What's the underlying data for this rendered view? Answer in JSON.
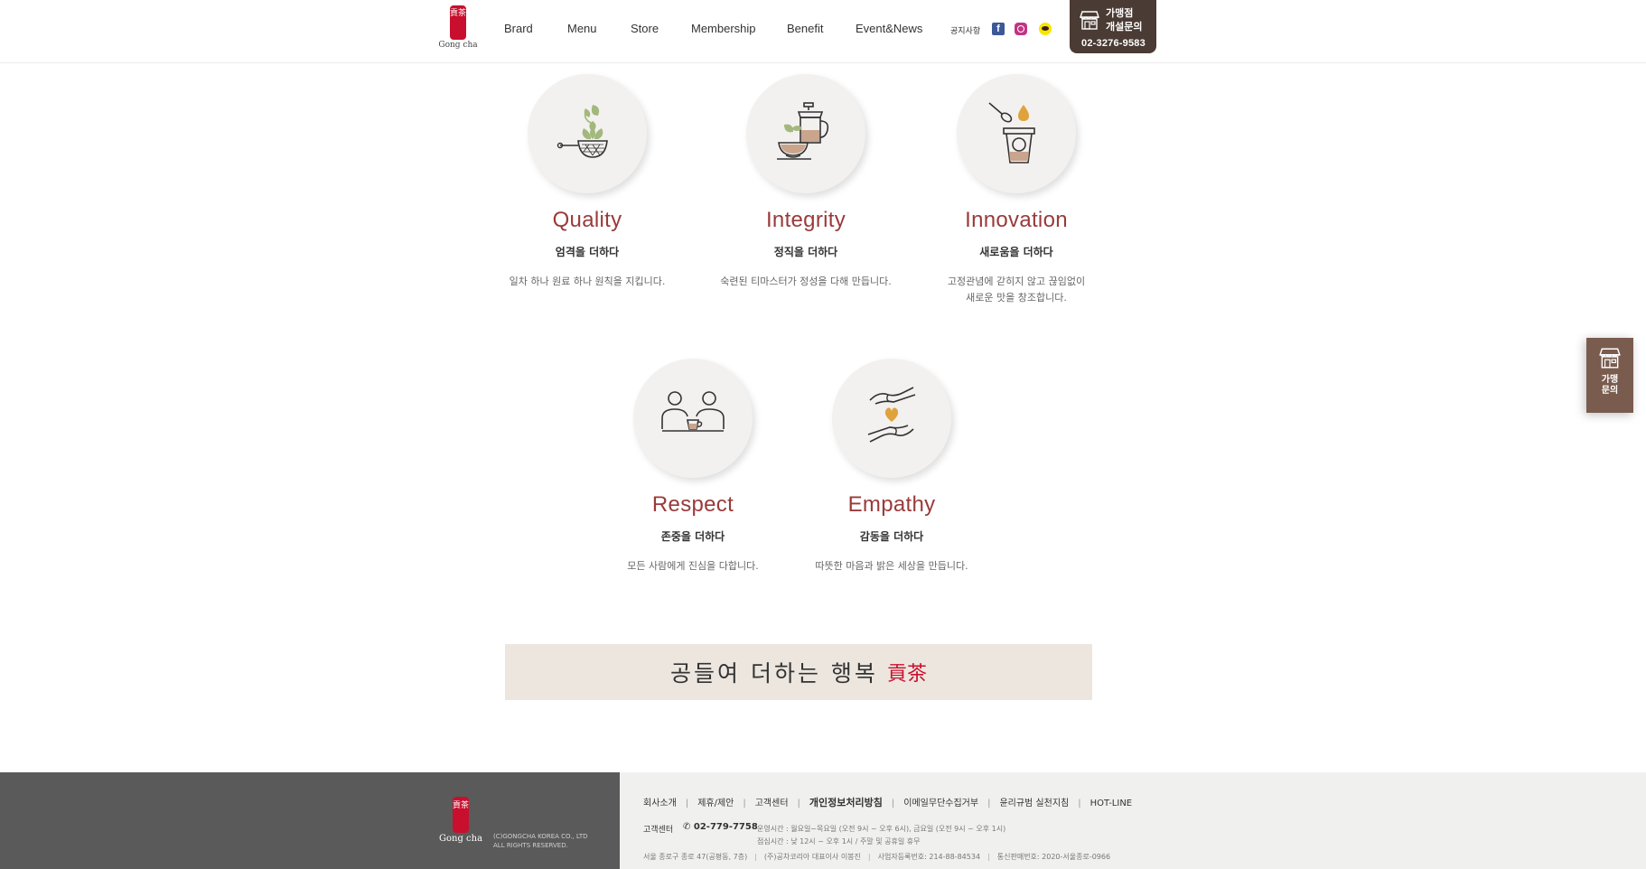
{
  "header": {
    "logo_text": "Gong cha",
    "logo_mark": "貢茶",
    "nav": [
      "Brard",
      "Menu",
      "Store",
      "Membership",
      "Benefit",
      "Event&News"
    ],
    "notice_label": "공지사항",
    "franchise": {
      "line1": "가맹점",
      "line2": "개설문의",
      "tel": "02-3276-9583"
    }
  },
  "values": [
    {
      "title": "Quality",
      "subtitle": "엄격을 더하다",
      "desc": "일차 하나 원료 하나 원칙을 지킵니다.",
      "icon": "tea-leaf-strainer-icon"
    },
    {
      "title": "Integrity",
      "subtitle": "정직을 더하다",
      "desc": "숙련된 티마스터가 정성을 다해 만듭니다.",
      "icon": "teapot-cup-icon"
    },
    {
      "title": "Innovation",
      "subtitle": "새로움을 더하다",
      "desc": "고정관념에 갇히지 않고 끊임없이\n새로운 맛을 창조합니다.",
      "icon": "spoon-drop-cup-icon"
    },
    {
      "title": "Respect",
      "subtitle": "존중을 더하다",
      "desc": "모든 사람에게 진심을 다합니다.",
      "icon": "two-people-cup-icon"
    },
    {
      "title": "Empathy",
      "subtitle": "감동을 더하다",
      "desc": "따뜻한 마음과 밝은 세상을 만듭니다.",
      "icon": "hands-heart-icon"
    }
  ],
  "banner": {
    "text": "공들여 더하는 행복",
    "mark": "貢茶"
  },
  "side_tab": {
    "label": "가맹\n문의"
  },
  "footer": {
    "logo_text": "Gong cha",
    "logo_mark": "貢茶",
    "copyright": "(C)GONGCHA KOREA CO., LTD\nALL RIGHTS RESERVED.",
    "links": [
      "회사소개",
      "제휴/제안",
      "고객센터",
      "개인정보처리방침",
      "이메일무단수집거부",
      "윤리규범 실천지침",
      "HOT-LINE"
    ],
    "cs_label": "고객센터",
    "cs_phone": "02-779-7758",
    "cs_hours_1": "운영시간 : 월요일~목요일 (오전 9시 ~ 오후 6시), 금요일 (오전 9시 ~ 오후 1시)",
    "cs_hours_2": "점심시간 : 낮 12시 ~ 오후 1시 / 주말 및 공휴일 휴무",
    "address": "서울 종로구 종로 47(공평동, 7층)",
    "ceo": "(주)공차코리아 대표이사 이봉진",
    "biz_no": "사업자등록번호: 214-88-84534",
    "mail_order": "통신판매번호: 2020-서울종로-0966"
  },
  "colors": {
    "accent": "#9a3a3a",
    "brand_red": "#c8102e",
    "franchise_brown": "#4a3b34",
    "footer_dark": "#5a5a5a"
  }
}
